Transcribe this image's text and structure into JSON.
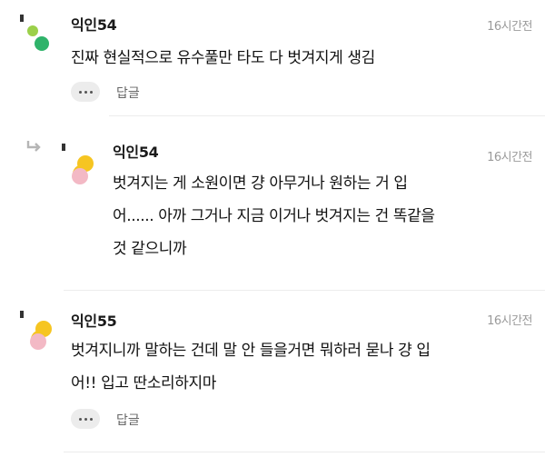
{
  "comments": [
    {
      "author": "익인54",
      "time": "16시간전",
      "text": "진짜 현실적으로 유수풀만 타도 다 벗겨지게 생김",
      "reply_label": "답글",
      "avatar_icon": "green-dots-avatar"
    },
    {
      "author": "익인54",
      "time": "16시간전",
      "text": "벗겨지는 게 소원이면 걍 아무거나 원하는 거 입\n어...... 아까 그거나 지금 이거나 벗겨지는 건 똑같을\n것 같으니까",
      "avatar_icon": "yellow-pink-avatar",
      "is_reply": true
    },
    {
      "author": "익인55",
      "time": "16시간전",
      "text": "벗겨지니까 말하는 건데 말 안 들을거면 뭐하러 묻나 걍 입\n어!! 입고 딴소리하지마",
      "reply_label": "답글",
      "avatar_icon": "yellow-pink-avatar"
    }
  ],
  "colors": {
    "accent_green_light": "#9bd04a",
    "accent_green_dark": "#2fb36a",
    "avatar_yellow": "#f6c521",
    "avatar_pink": "#f3b9c5"
  }
}
